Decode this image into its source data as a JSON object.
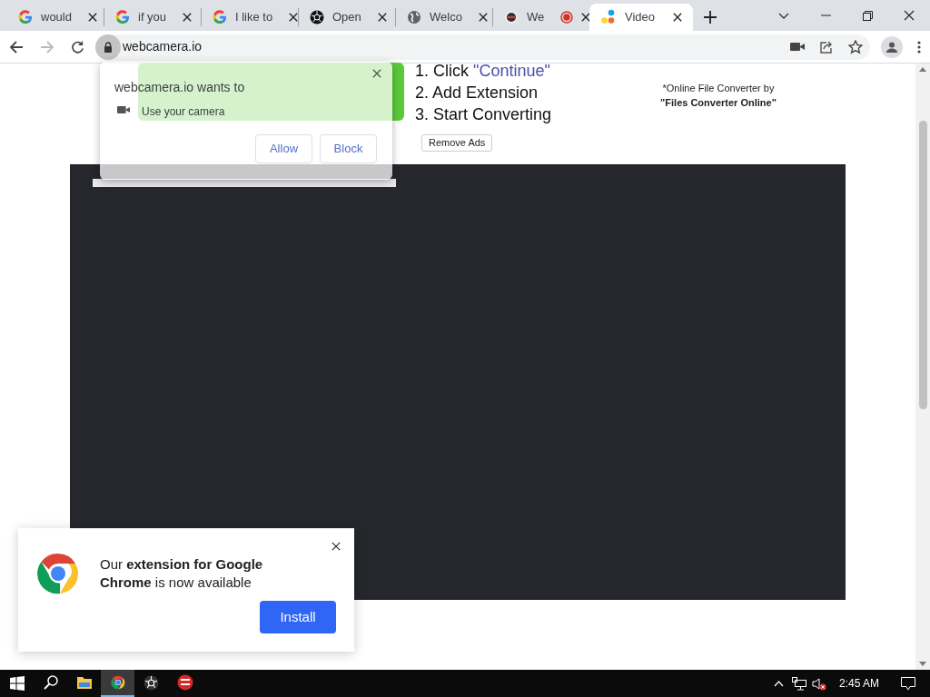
{
  "tabs": [
    {
      "title": "would",
      "kind": "google",
      "selected": false
    },
    {
      "title": "if you",
      "kind": "google",
      "selected": false
    },
    {
      "title": "I like to",
      "kind": "google",
      "selected": false
    },
    {
      "title": "Open",
      "kind": "aperture",
      "selected": false
    },
    {
      "title": "Welco",
      "kind": "globe",
      "selected": false
    },
    {
      "title": "We",
      "kind": "recorder",
      "selected": false,
      "recording": true
    },
    {
      "title": "Video",
      "kind": "dots",
      "selected": true
    }
  ],
  "address_bar": {
    "url": "webcamera.io"
  },
  "ad": {
    "steps": [
      {
        "text": "1. Click",
        "link": "\"Continue\""
      },
      {
        "text": "2. Add Extension"
      },
      {
        "text": "3. Start Converting"
      }
    ],
    "note": [
      "*Online File Converter by",
      "\"Files Converter Online\""
    ],
    "remove_ads": "Remove Ads"
  },
  "permission_popup": {
    "title": "webcamera.io wants to",
    "permission": "Use your camera",
    "buttons": [
      "Allow",
      "Block"
    ]
  },
  "toast": {
    "message": "Our **extension for Google Chrome** is now available",
    "button": "Install"
  },
  "taskbar": {
    "apps": [
      {
        "kind": "search",
        "selected": false
      },
      {
        "kind": "folder",
        "selected": false
      },
      {
        "kind": "chrome",
        "selected": true
      },
      {
        "kind": "aperture",
        "selected": false
      },
      {
        "kind": "devcpp",
        "selected": false
      }
    ],
    "clock": "2:45 AM"
  }
}
